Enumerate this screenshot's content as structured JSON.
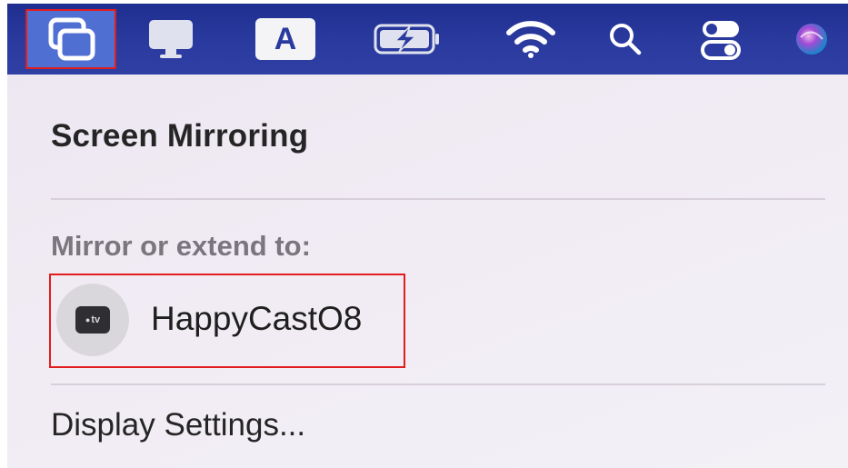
{
  "menubar": {
    "items": [
      {
        "name": "screen-mirroring-icon"
      },
      {
        "name": "display-icon"
      },
      {
        "name": "input-source",
        "label": "A"
      },
      {
        "name": "battery-charging-icon"
      },
      {
        "name": "wifi-icon"
      },
      {
        "name": "spotlight-search-icon"
      },
      {
        "name": "control-center-icon"
      },
      {
        "name": "siri-icon"
      }
    ]
  },
  "menu": {
    "title": "Screen Mirroring",
    "section_label": "Mirror or extend to:",
    "device": {
      "name": "HappyCastO8",
      "icon": "apple-tv-icon",
      "icon_text": "tv"
    },
    "footer_item": "Display Settings..."
  },
  "colors": {
    "menubar": "#2a3a9e",
    "highlight": "#4f6fd2",
    "annotation": "#e11d1d",
    "panel": "#f1ecf4"
  }
}
